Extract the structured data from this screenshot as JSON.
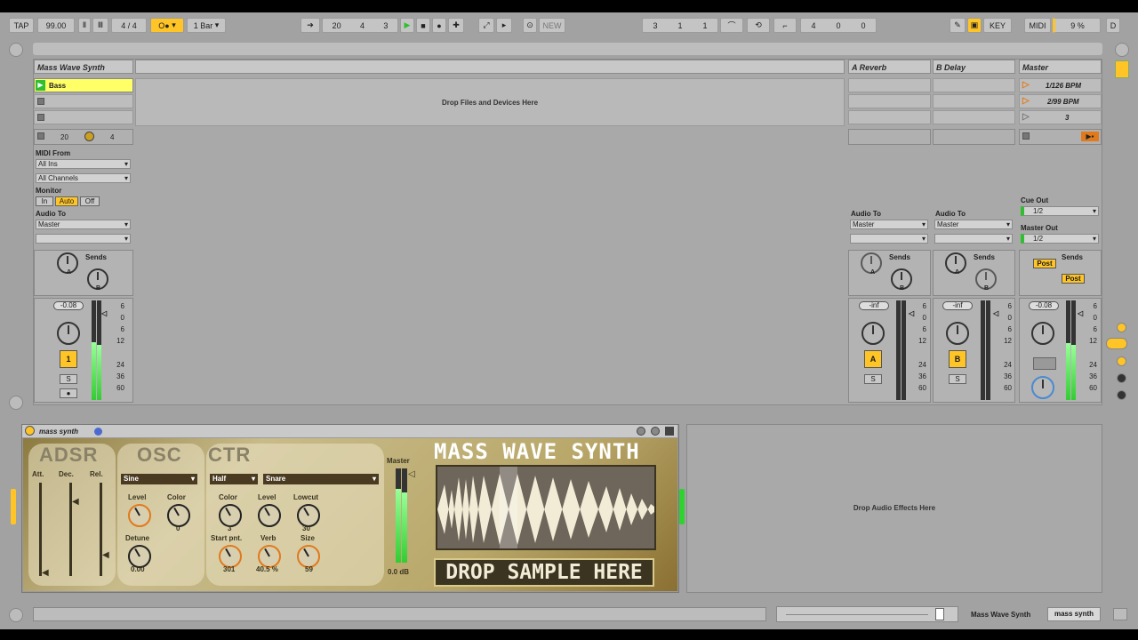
{
  "transport": {
    "tap": "TAP",
    "bpm": "99.00",
    "sig_num": "4",
    "sig_sep": "/",
    "sig_den": "4",
    "quant": "1 Bar",
    "pos": [
      "20",
      "4",
      "3"
    ],
    "loop_pos": [
      "3",
      "1",
      "1"
    ],
    "loop_len": [
      "4",
      "0",
      "0"
    ],
    "new": "NEW",
    "key": "KEY",
    "midi": "MIDI",
    "cpu": "9 %",
    "d": "D",
    "metro": "O●"
  },
  "tracks": {
    "synth": {
      "title": "Mass Wave Synth",
      "clip": "Bass",
      "count": "20",
      "count2": "4",
      "midi_from": "MIDI From",
      "in_src": "All Ins",
      "channels": "All Channels",
      "monitor": "Monitor",
      "mon_in": "In",
      "mon_auto": "Auto",
      "mon_off": "Off",
      "audio_to": "Audio To",
      "audio_dest": "Master",
      "sends": "Sends",
      "send_a": "A",
      "send_b": "B",
      "vol": "-0.08",
      "num": "1",
      "s": "S"
    },
    "drop_main": "Drop Files and Devices Here",
    "a_reverb": {
      "title": "A Reverb",
      "audio_to": "Audio To",
      "dest": "Master",
      "sends": "Sends",
      "send_a": "A",
      "send_b": "B",
      "vol": "-inf",
      "label": "A",
      "s": "S"
    },
    "b_delay": {
      "title": "B Delay",
      "audio_to": "Audio To",
      "dest": "Master",
      "sends": "Sends",
      "send_a": "A",
      "send_b": "B",
      "vol": "-inf",
      "label": "B",
      "s": "S"
    },
    "master": {
      "title": "Master",
      "scenes": [
        "1/126 BPM",
        "2/99 BPM",
        "3"
      ],
      "cue_out": "Cue Out",
      "cue_dest": "1/2",
      "master_out": "Master Out",
      "master_dest": "1/2",
      "sends": "Sends",
      "post1": "Post",
      "post2": "Post",
      "vol": "-0.08"
    }
  },
  "scale": [
    "6",
    "0",
    "6",
    "12",
    "24",
    "36",
    "60"
  ],
  "device": {
    "name": "mass synth",
    "title": "MASS WAVE SYNTH",
    "drop_sample": "DROP SAMPLE HERE",
    "adsr": "ADSR",
    "att": "Att.",
    "dec": "Dec.",
    "rel": "Rel.",
    "osc": "OSC",
    "osc_wave": "Sine",
    "level": "Level",
    "color": "Color",
    "color_val": "0",
    "detune": "Detune",
    "detune_val": "0.00",
    "ctr": "CTR",
    "ctr_mode": "Half",
    "ctr_sample": "Snare",
    "c_color": "Color",
    "c_color_val": "3",
    "c_level": "Level",
    "lowcut": "Lowcut",
    "lowcut_val": "30",
    "start": "Start pnt.",
    "start_val": "301",
    "verb": "Verb",
    "verb_val": "40.5 %",
    "size": "Size",
    "size_val": "59",
    "master": "Master",
    "master_val": "0.0 dB"
  },
  "drop_effects": "Drop Audio Effects Here",
  "status": {
    "track": "Mass Wave Synth",
    "device": "mass synth"
  },
  "colors": {
    "accent": "#ffc425",
    "bg": "#a9a9a9",
    "green": "#2fd22f"
  }
}
